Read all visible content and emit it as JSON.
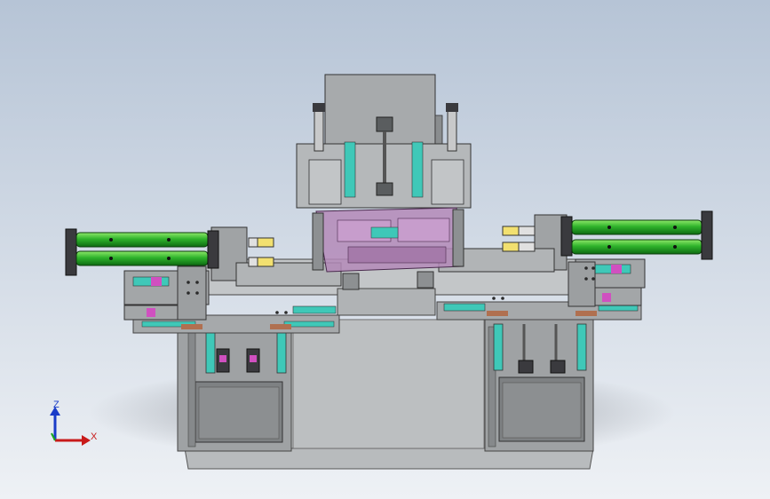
{
  "viewport": {
    "background_top": "#b6c4d6",
    "background_bottom": "#eef1f5"
  },
  "colors": {
    "frame_gray": "#a9acae",
    "frame_dark": "#6d7072",
    "frame_light": "#c9cbcc",
    "cylinder_green": "#2fb32b",
    "fixture_purple": "#b48ab8",
    "rail_teal": "#3fc8b8",
    "brass_yellow": "#f2e070",
    "copper_pad": "#b07050",
    "magenta_part": "#d050c0"
  },
  "triad": {
    "z_label": "Z",
    "x_label": "X",
    "z_color": "#1a3cc8",
    "x_color": "#c81a1a",
    "y_color": "#1aa81a"
  }
}
